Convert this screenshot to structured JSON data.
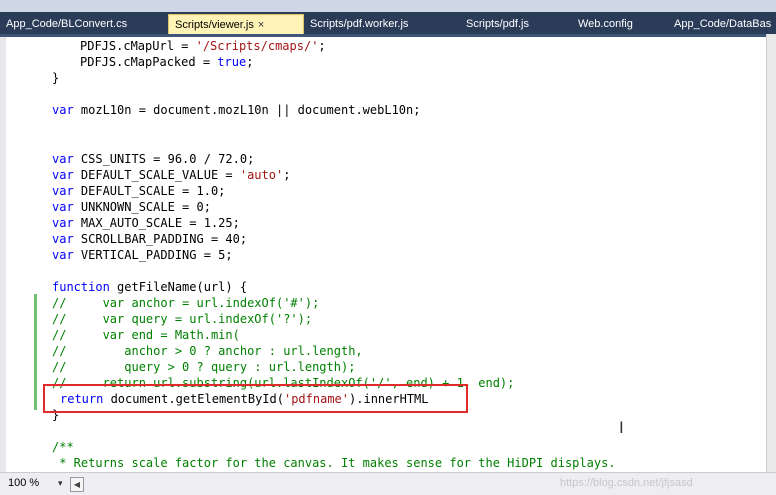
{
  "tabs": [
    {
      "label": "App_Code/BLConvert.cs"
    },
    {
      "label": "Scripts/viewer.js",
      "close": "×"
    },
    {
      "label": "Scripts/pdf.worker.js"
    },
    {
      "label": "Scripts/pdf.js"
    },
    {
      "label": "Web.config"
    },
    {
      "label": "App_Code/DataBas"
    }
  ],
  "code": {
    "l1": [
      "PDFJS.cMapUrl = ",
      "'/Scripts/cmaps/'",
      ";"
    ],
    "l2": [
      "PDFJS.cMapPacked = ",
      "true",
      ";"
    ],
    "l3": "}",
    "l4": [
      "var",
      " mozL10n = document.mozL10n || document.webL10n;"
    ],
    "l5": [
      "var",
      " CSS_UNITS = 96.0 / 72.0;"
    ],
    "l6": [
      "var",
      " DEFAULT_SCALE_VALUE = ",
      "'auto'",
      ";"
    ],
    "l7": [
      "var",
      " DEFAULT_SCALE = 1.0;"
    ],
    "l8": [
      "var",
      " UNKNOWN_SCALE = 0;"
    ],
    "l9": [
      "var",
      " MAX_AUTO_SCALE = 1.25;"
    ],
    "l10": [
      "var",
      " SCROLLBAR_PADDING = 40;"
    ],
    "l11": [
      "var",
      " VERTICAL_PADDING = 5;"
    ],
    "l12": [
      "function",
      " getFileName(url) {"
    ],
    "c1": "//     var anchor = url.indexOf('#');",
    "c2": "//     var query = url.indexOf('?');",
    "c3": "//     var end = Math.min(",
    "c4": "//        anchor > 0 ? anchor : url.length,",
    "c5": "//        query > 0 ? query : url.length);",
    "c6": "//     return url.substring(url.lastIndexOf('/', end) + 1, end);",
    "r1": [
      "return",
      " document.getElementById(",
      "'pdfname'",
      ").innerHTML"
    ],
    "l13": "}",
    "d1": "/**",
    "d2": " * Returns scale factor for the canvas. It makes sense for the HiDPI displays."
  },
  "status": {
    "zoom": "100 %",
    "zoom_arrow": "▾",
    "scroll_left": "◀",
    "watermark": "https://blog.csdn.net/jfjsasd"
  },
  "colors": {
    "keyword": "#0000ff",
    "string": "#a31515",
    "comment": "#008000",
    "highlight_box": "#e02b2b",
    "active_tab": "#fff3b8",
    "tab_bar": "#2b3c59"
  }
}
